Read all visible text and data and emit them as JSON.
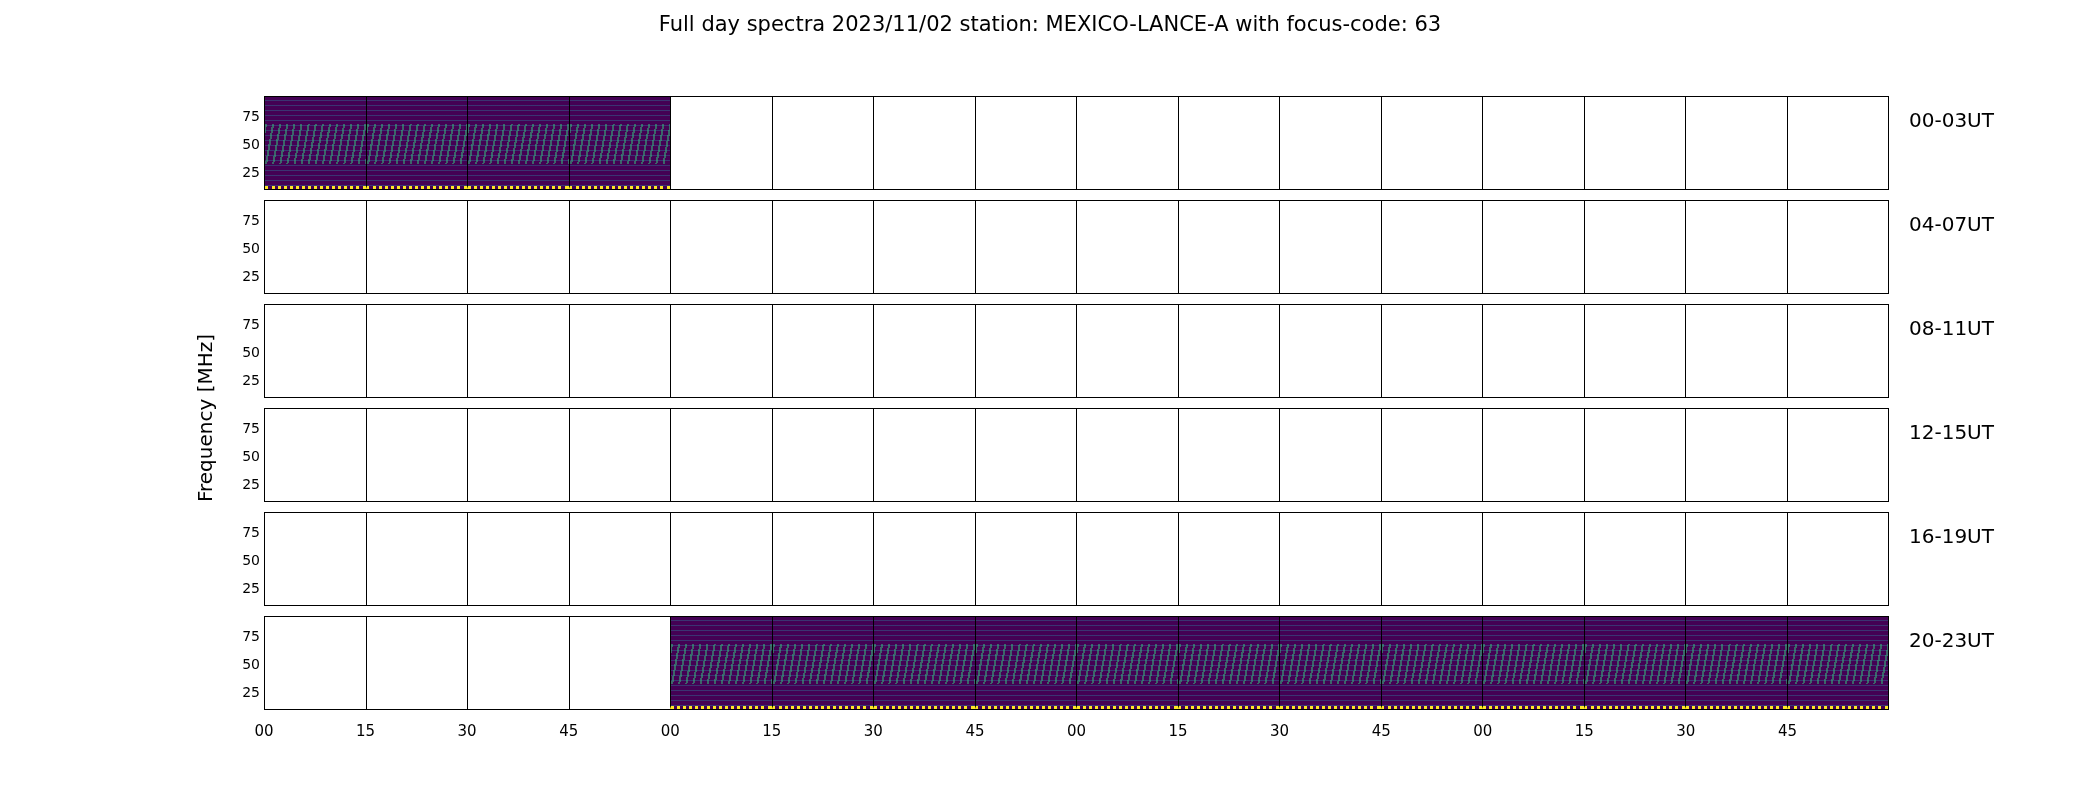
{
  "title": "Full day spectra 2023/11/02 station: MEXICO-LANCE-A with focus-code: 63",
  "ylabel": "Frequency [MHz]",
  "rows": [
    {
      "label": "00-03UT",
      "yticks": [
        "75",
        "50",
        "25"
      ],
      "panels": [
        {
          "filled": true
        },
        {
          "filled": true
        },
        {
          "filled": true
        },
        {
          "filled": true
        },
        {
          "filled": false
        },
        {
          "filled": false
        },
        {
          "filled": false
        },
        {
          "filled": false
        },
        {
          "filled": false
        },
        {
          "filled": false
        },
        {
          "filled": false
        },
        {
          "filled": false
        },
        {
          "filled": false
        },
        {
          "filled": false
        },
        {
          "filled": false
        },
        {
          "filled": false
        }
      ]
    },
    {
      "label": "04-07UT",
      "yticks": [
        "75",
        "50",
        "25"
      ],
      "panels": [
        {
          "filled": false
        },
        {
          "filled": false
        },
        {
          "filled": false
        },
        {
          "filled": false
        },
        {
          "filled": false
        },
        {
          "filled": false
        },
        {
          "filled": false
        },
        {
          "filled": false
        },
        {
          "filled": false
        },
        {
          "filled": false
        },
        {
          "filled": false
        },
        {
          "filled": false
        },
        {
          "filled": false
        },
        {
          "filled": false
        },
        {
          "filled": false
        },
        {
          "filled": false
        }
      ]
    },
    {
      "label": "08-11UT",
      "yticks": [
        "75",
        "50",
        "25"
      ],
      "panels": [
        {
          "filled": false
        },
        {
          "filled": false
        },
        {
          "filled": false
        },
        {
          "filled": false
        },
        {
          "filled": false
        },
        {
          "filled": false
        },
        {
          "filled": false
        },
        {
          "filled": false
        },
        {
          "filled": false
        },
        {
          "filled": false
        },
        {
          "filled": false
        },
        {
          "filled": false
        },
        {
          "filled": false
        },
        {
          "filled": false
        },
        {
          "filled": false
        },
        {
          "filled": false
        }
      ]
    },
    {
      "label": "12-15UT",
      "yticks": [
        "75",
        "50",
        "25"
      ],
      "panels": [
        {
          "filled": false
        },
        {
          "filled": false
        },
        {
          "filled": false
        },
        {
          "filled": false
        },
        {
          "filled": false
        },
        {
          "filled": false
        },
        {
          "filled": false
        },
        {
          "filled": false
        },
        {
          "filled": false
        },
        {
          "filled": false
        },
        {
          "filled": false
        },
        {
          "filled": false
        },
        {
          "filled": false
        },
        {
          "filled": false
        },
        {
          "filled": false
        },
        {
          "filled": false
        }
      ]
    },
    {
      "label": "16-19UT",
      "yticks": [
        "75",
        "50",
        "25"
      ],
      "panels": [
        {
          "filled": false
        },
        {
          "filled": false
        },
        {
          "filled": false
        },
        {
          "filled": false
        },
        {
          "filled": false
        },
        {
          "filled": false
        },
        {
          "filled": false
        },
        {
          "filled": false
        },
        {
          "filled": false
        },
        {
          "filled": false
        },
        {
          "filled": false
        },
        {
          "filled": false
        },
        {
          "filled": false
        },
        {
          "filled": false
        },
        {
          "filled": false
        },
        {
          "filled": false
        }
      ]
    },
    {
      "label": "20-23UT",
      "yticks": [
        "75",
        "50",
        "25"
      ],
      "panels": [
        {
          "filled": false
        },
        {
          "filled": false
        },
        {
          "filled": false
        },
        {
          "filled": false
        },
        {
          "filled": true
        },
        {
          "filled": true
        },
        {
          "filled": true
        },
        {
          "filled": true
        },
        {
          "filled": true
        },
        {
          "filled": true
        },
        {
          "filled": true
        },
        {
          "filled": true
        },
        {
          "filled": true
        },
        {
          "filled": true
        },
        {
          "filled": true
        },
        {
          "filled": true
        }
      ]
    }
  ],
  "xticks": [
    "00",
    "15",
    "30",
    "45",
    "00",
    "15",
    "30",
    "45",
    "00",
    "15",
    "30",
    "45",
    "00",
    "15",
    "30",
    "45"
  ]
}
